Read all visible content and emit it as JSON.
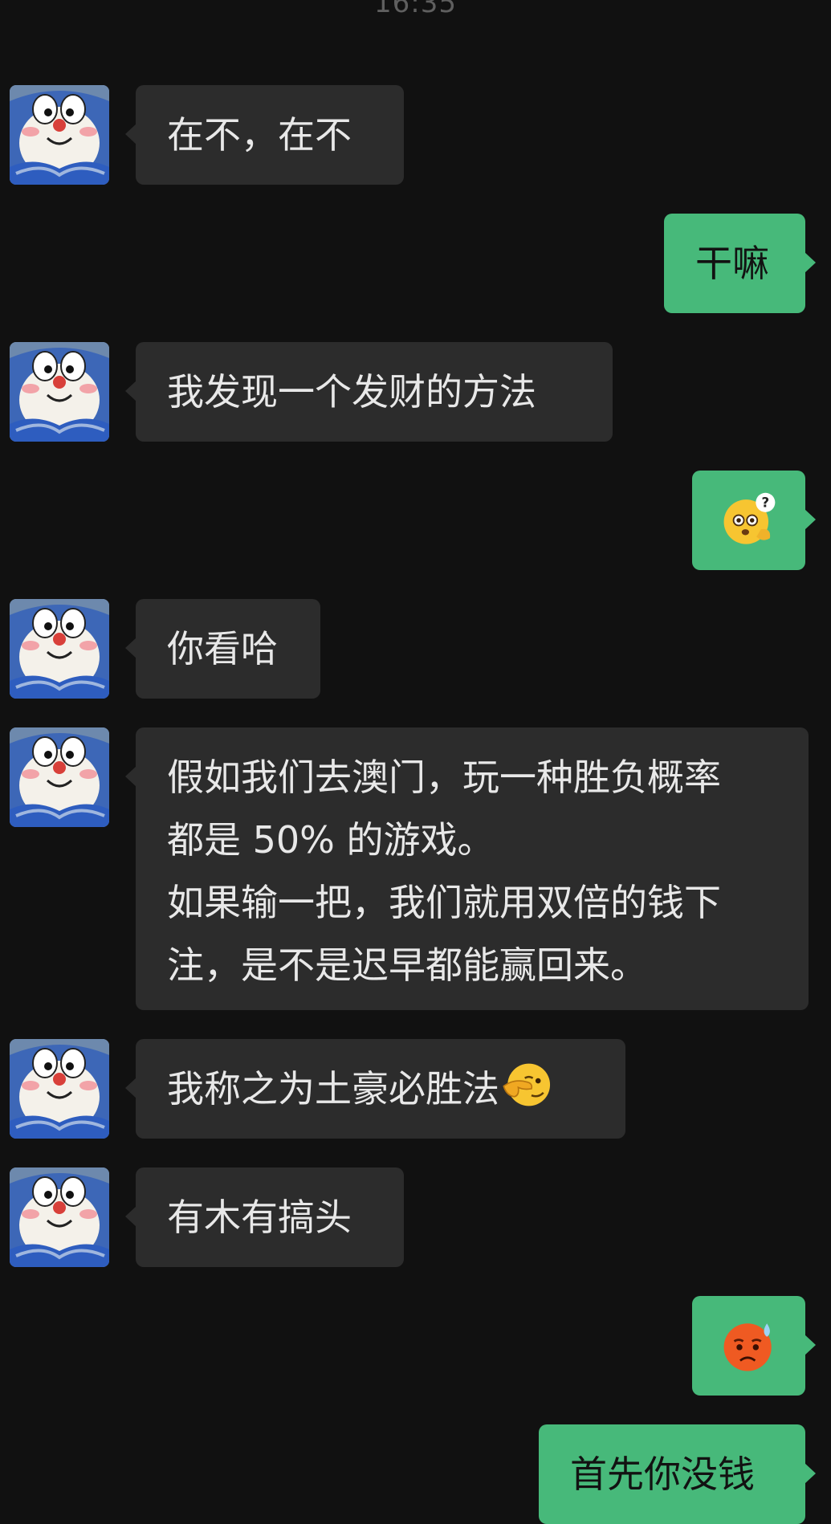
{
  "status_bar": {
    "time": "16:35"
  },
  "contact": {
    "avatar_icon": "doraemon-cat-avatar-icon"
  },
  "messages": [
    {
      "sender": "them",
      "lines": [
        "在不，在不"
      ]
    },
    {
      "sender": "me",
      "lines": [
        "干嘛"
      ]
    },
    {
      "sender": "them",
      "lines": [
        "我发现一个发财的方法"
      ]
    },
    {
      "sender": "me",
      "emoji": "confused-question-emoji"
    },
    {
      "sender": "them",
      "lines": [
        "你看哈"
      ]
    },
    {
      "sender": "them",
      "lines": [
        "假如我们去澳门，玩一种胜负概率",
        "都是 50% 的游戏。",
        "如果输一把，我们就用双倍的钱下",
        "注，是不是迟早都能赢回来。"
      ]
    },
    {
      "sender": "them",
      "lines": [
        "我称之为土豪必胜法"
      ],
      "trailing_emoji": "smirk-hand-over-face-emoji"
    },
    {
      "sender": "them",
      "lines": [
        "有木有搞头"
      ]
    },
    {
      "sender": "me",
      "emoji": "sweat-frown-emoji"
    },
    {
      "sender": "me",
      "lines": [
        "首先你没钱"
      ]
    }
  ],
  "colors": {
    "background": "#111111",
    "incoming_bubble": "#2c2c2c",
    "outgoing_bubble": "#47b97a",
    "incoming_text": "#e8e8e8",
    "outgoing_text": "#121212"
  }
}
